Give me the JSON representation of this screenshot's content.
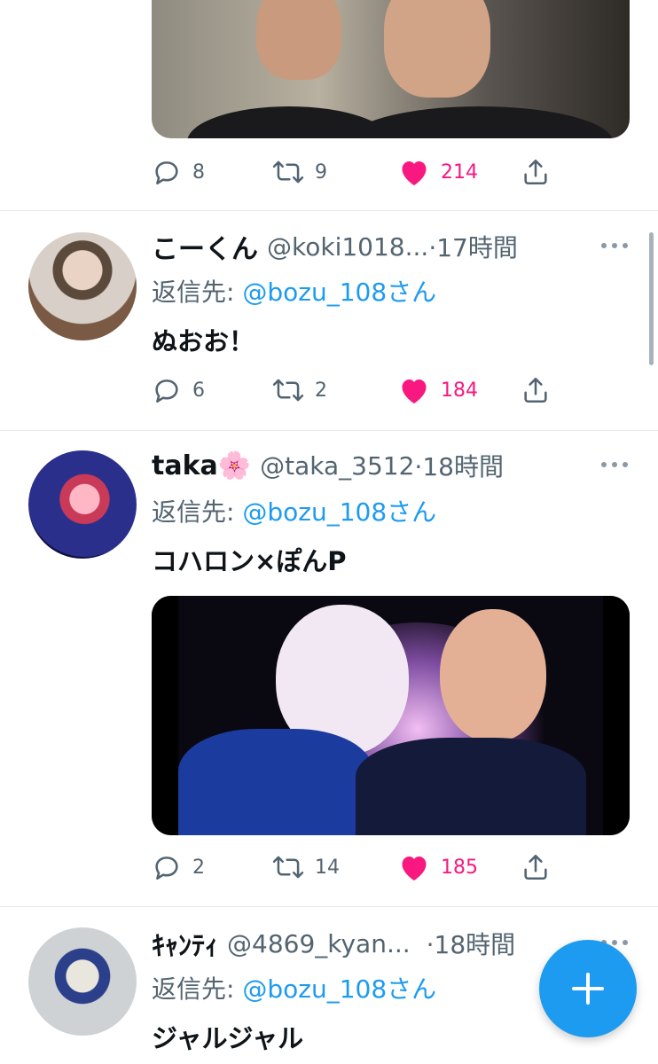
{
  "tweets": [
    {
      "stats": {
        "replies": "8",
        "retweets": "9",
        "likes": "214"
      }
    },
    {
      "name": "こーくん",
      "handle": "@koki1018...",
      "time": "·17時間",
      "reply_label": "返信先: ",
      "reply_to": "@bozu_108さん",
      "text": "ぬおお！",
      "stats": {
        "replies": "6",
        "retweets": "2",
        "likes": "184"
      }
    },
    {
      "name": "taka🌸",
      "handle": "@taka_3512",
      "time": "·18時間",
      "reply_label": "返信先: ",
      "reply_to": "@bozu_108さん",
      "text": "コハロン×ぽんP",
      "stats": {
        "replies": "2",
        "retweets": "14",
        "likes": "185"
      }
    },
    {
      "name": "ｷｬﾝﾃｨ",
      "handle": "@4869_kyan...",
      "time": "·18時間",
      "reply_label": "返信先: ",
      "reply_to": "@bozu_108さん",
      "text": "ジャルジャル"
    }
  ],
  "icons": {
    "reply": "reply-icon",
    "retweet": "retweet-icon",
    "like": "heart-icon",
    "share": "share-icon",
    "more": "more-icon",
    "compose": "plus-icon"
  },
  "colors": {
    "accent": "#1d9bf0",
    "like": "#f91880",
    "secondary_text": "#536471"
  }
}
